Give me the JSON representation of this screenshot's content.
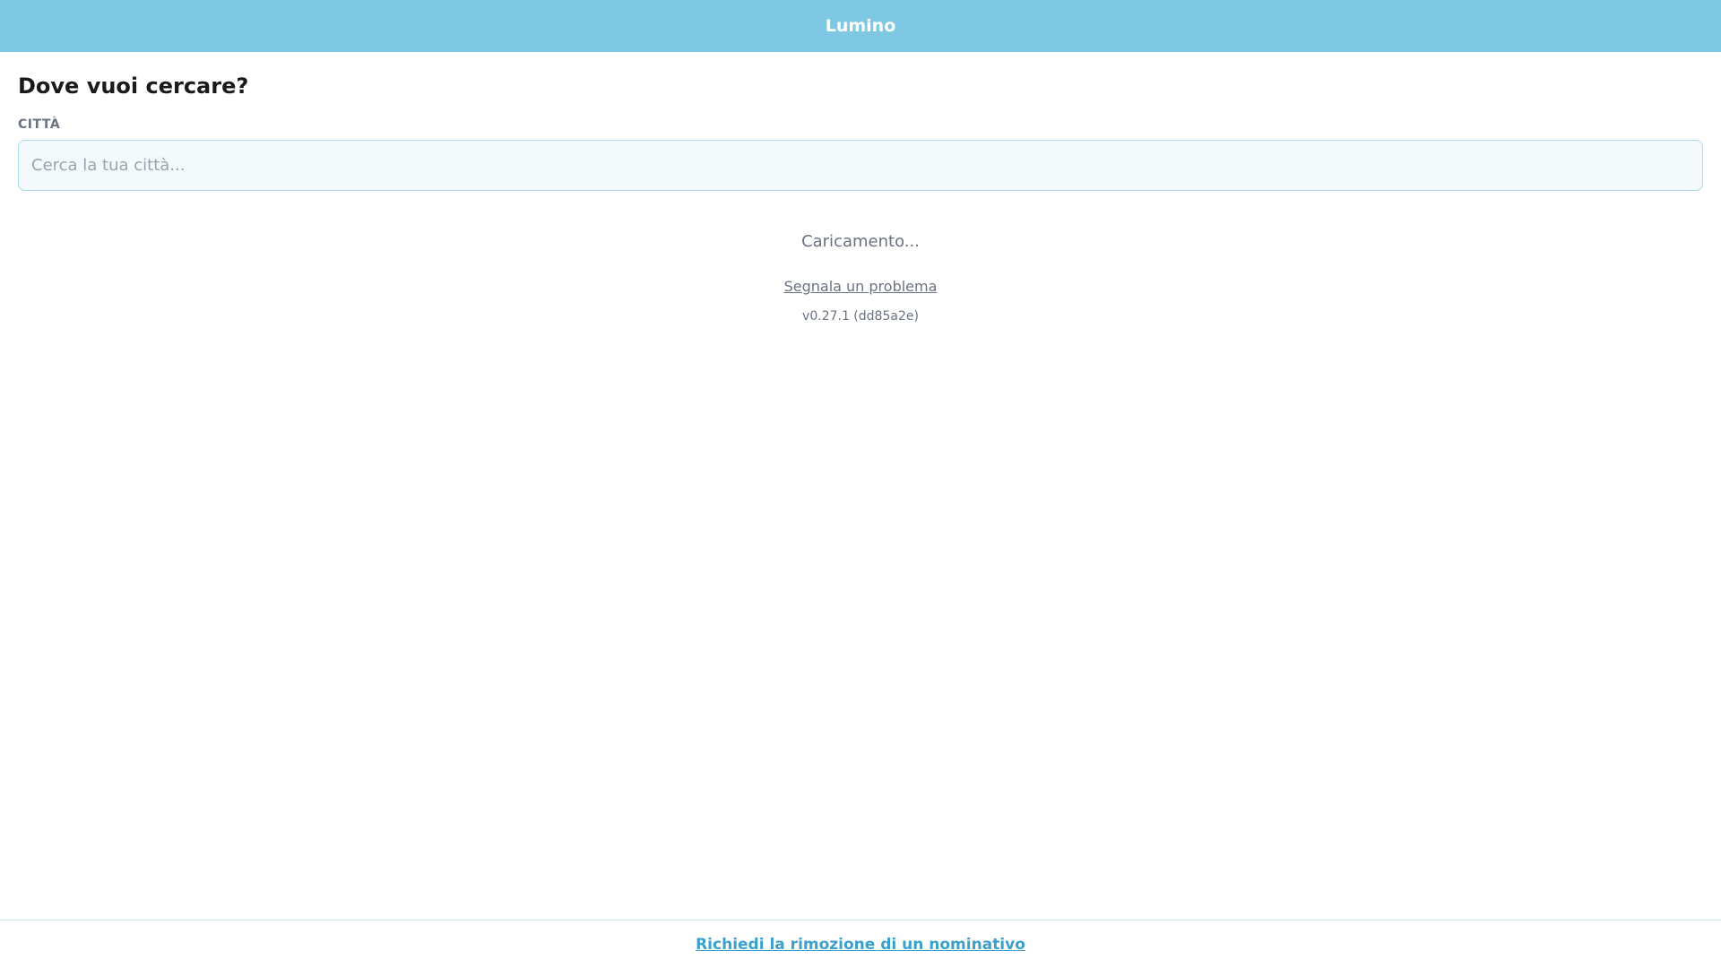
{
  "header": {
    "title": "Lumino"
  },
  "main": {
    "title": "Dove vuoi cercare?",
    "city_label": "CITTÀ",
    "city_input": {
      "value": "",
      "placeholder": "Cerca la tua città..."
    },
    "loading_text": "Caricamento...",
    "report_link": "Segnala un problema",
    "version": "v0.27.1 (dd85a2e)"
  },
  "footer": {
    "removal_link": "Richiedi la rimozione di un nominativo"
  },
  "colors": {
    "header_bg": "#7ec8e3",
    "accent_link": "#3aa0cc",
    "input_bg": "#f4f9fc",
    "input_border": "#a9dbec"
  }
}
